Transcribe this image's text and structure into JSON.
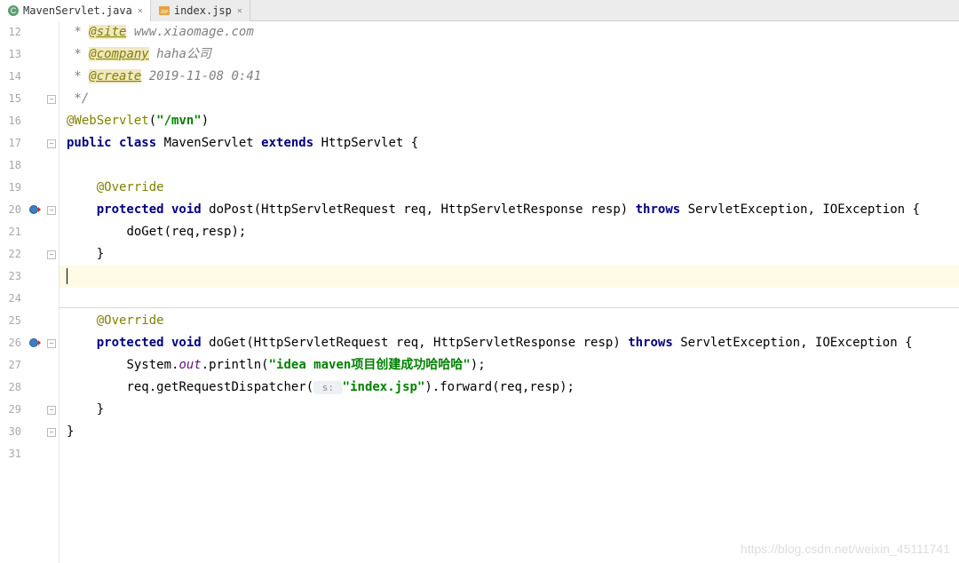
{
  "tabs": [
    {
      "label": "MavenServlet.java",
      "icon": "class",
      "active": true
    },
    {
      "label": "index.jsp",
      "icon": "jsp",
      "active": false
    }
  ],
  "lines": {
    "start": 12,
    "end": 31,
    "highlighted": 23
  },
  "code": {
    "l12_pre": " * ",
    "l12_tag": "@site",
    "l12_rest": " www.xiaomage.com",
    "l13_pre": " * ",
    "l13_tag": "@company",
    "l13_rest": " haha公司",
    "l14_pre": " * ",
    "l14_tag": "@create",
    "l14_rest": " 2019-11-08 0:41",
    "l15": " */",
    "l16_ann": "@WebServlet",
    "l16_p1": "(",
    "l16_str": "\"/mvn\"",
    "l16_p2": ")",
    "l17_kw1": "public class ",
    "l17_name": "MavenServlet ",
    "l17_kw2": "extends ",
    "l17_super": "HttpServlet {",
    "l19_ann": "@Override",
    "l20_kw": "protected void ",
    "l20_name": "doPost",
    "l20_sig_a": "(HttpServletRequest req, HttpServletResponse resp) ",
    "l20_kw2": "throws ",
    "l20_sig_b": "ServletException, IOException {",
    "l21": "doGet(req,resp);",
    "l22": "}",
    "l25_ann": "@Override",
    "l26_kw": "protected void ",
    "l26_name": "doGet",
    "l26_sig_a": "(HttpServletRequest req, HttpServletResponse resp) ",
    "l26_kw2": "throws ",
    "l26_sig_b": "ServletException, IOException {",
    "l27_a": "System.",
    "l27_out": "out",
    "l27_b": ".println(",
    "l27_str": "\"idea maven项目创建成功哈哈哈\"",
    "l27_c": ");",
    "l28_a": "req.getRequestDispatcher(",
    "l28_hint": " s: ",
    "l28_str": "\"index.jsp\"",
    "l28_b": ").forward(req,resp);",
    "l29": "}",
    "l30": "}"
  },
  "watermark": "https://blog.csdn.net/weixin_45111741"
}
